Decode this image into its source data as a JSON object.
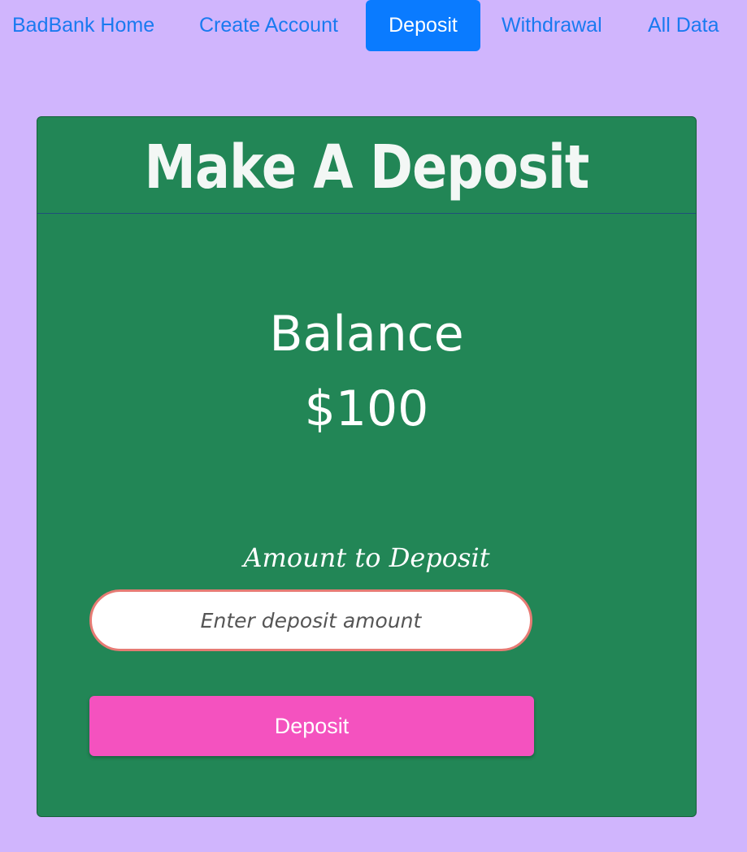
{
  "nav": {
    "home": "BadBank Home",
    "create_account": "Create Account",
    "deposit": "Deposit",
    "withdrawal": "Withdrawal",
    "all_data": "All Data",
    "active": "Deposit",
    "active_color": "#0a7bff",
    "link_color": "#1a7af0"
  },
  "card": {
    "title": "Make A Deposit",
    "balance_label": "Balance",
    "balance_value": "$100",
    "amount_label": "Amount to Deposit",
    "input_placeholder": "Enter deposit amount",
    "input_value": "",
    "submit_label": "Deposit",
    "background_color": "#228656",
    "button_color": "#f452bf"
  },
  "page": {
    "background_color": "#d0b5fd"
  }
}
